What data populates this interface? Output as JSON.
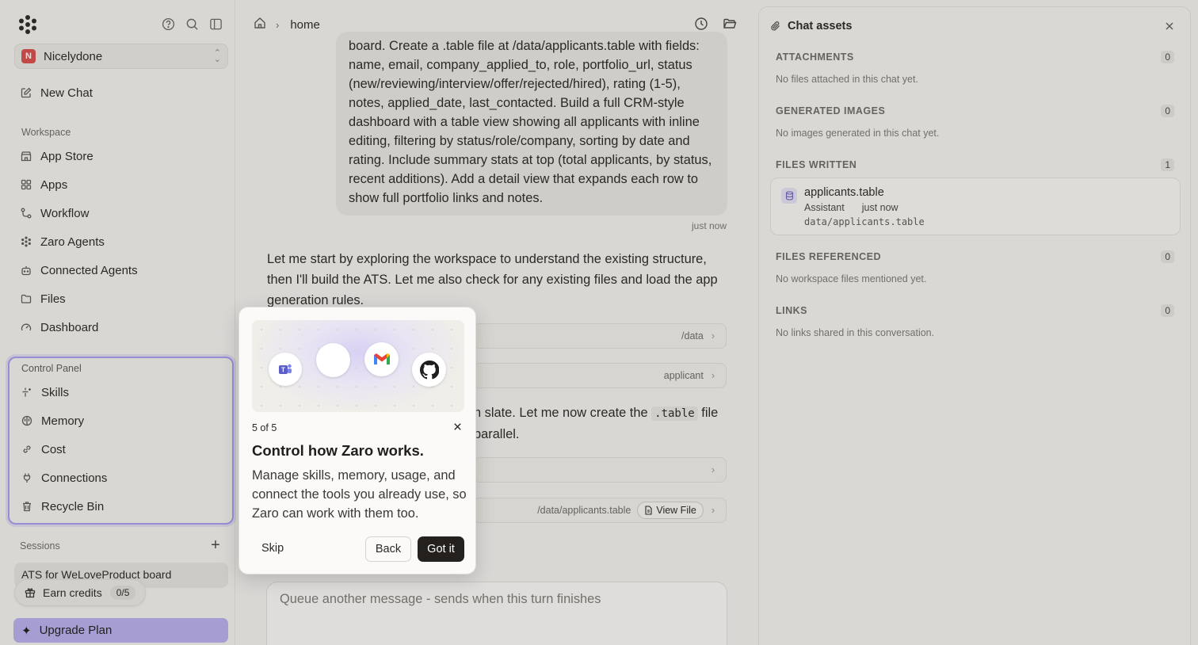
{
  "sidebar": {
    "workspace": {
      "initial": "N",
      "name": "Nicelydone"
    },
    "new_chat": "New Chat",
    "workspace_label": "Workspace",
    "nav": [
      {
        "label": "App Store",
        "icon": "store-icon"
      },
      {
        "label": "Apps",
        "icon": "grid-icon"
      },
      {
        "label": "Workflow",
        "icon": "workflow-icon"
      },
      {
        "label": "Zaro Agents",
        "icon": "zaro-agents-icon"
      },
      {
        "label": "Connected Agents",
        "icon": "robot-icon"
      },
      {
        "label": "Files",
        "icon": "folder-icon"
      },
      {
        "label": "Dashboard",
        "icon": "gauge-icon"
      }
    ],
    "control_panel": {
      "label": "Control Panel",
      "items": [
        {
          "label": "Skills",
          "icon": "sparkle-icon"
        },
        {
          "label": "Memory",
          "icon": "brain-icon"
        },
        {
          "label": "Cost",
          "icon": "link-icon"
        },
        {
          "label": "Connections",
          "icon": "plug-icon"
        },
        {
          "label": "Recycle Bin",
          "icon": "trash-icon"
        }
      ]
    },
    "sessions_label": "Sessions",
    "session_item": "ATS for WeLoveProduct board",
    "earn_credits": {
      "label": "Earn credits",
      "count": "0/5"
    },
    "upgrade": "Upgrade Plan"
  },
  "main": {
    "breadcrumb": "home",
    "user_message": "board. Create a .table file at /data/applicants.table with fields: name, email, company_applied_to, role, portfolio_url, status (new/reviewing/interview/offer/rejected/hired), rating (1-5), notes, applied_date, last_contacted. Build a full CRM-style dashboard with a table view showing all applicants with inline editing, filtering by status/role/company, sorting by date and rating. Include summary stats at top (total applicants, by status, recent additions). Add a detail view that expands each row to show full portfolio links and notes.",
    "message_time": "just now",
    "assistant_message": "Let me start by exploring the workspace to understand the existing structure, then I'll build the ATS. Let me also check for any existing files and load the app generation rules.",
    "tool_rows": [
      {
        "detail": "/data"
      },
      {
        "detail": "applicant"
      },
      {
        "detail": ""
      },
      {
        "detail": "/data/applicants.table",
        "action": "View File"
      }
    ],
    "assistant_message2": {
      "part1": "n slate. Let me now create the ",
      "code": ".table",
      "part2": " file",
      "part3": "parallel."
    },
    "composer_placeholder": "Queue another message - sends when this turn finishes"
  },
  "assets": {
    "title": "Chat assets",
    "sections": [
      {
        "title": "ATTACHMENTS",
        "count": "0",
        "empty": "No files attached in this chat yet."
      },
      {
        "title": "GENERATED IMAGES",
        "count": "0",
        "empty": "No images generated in this chat yet."
      },
      {
        "title": "FILES WRITTEN",
        "count": "1"
      },
      {
        "title": "FILES REFERENCED",
        "count": "0",
        "empty": "No workspace files mentioned yet."
      },
      {
        "title": "LINKS",
        "count": "0",
        "empty": "No links shared in this conversation."
      }
    ],
    "file": {
      "name": "applicants.table",
      "author": "Assistant",
      "time": "just now",
      "path": "data/applicants.table"
    }
  },
  "tour": {
    "step": "5 of 5",
    "title": "Control how Zaro works.",
    "body": "Manage skills, memory, usage, and connect the tools you already use, so Zaro can work with them too.",
    "skip": "Skip",
    "back": "Back",
    "got_it": "Got it",
    "hero_icons": [
      "teams-icon",
      "blank-circle",
      "gmail-icon",
      "github-icon"
    ]
  },
  "colors": {
    "accent": "#a79df0",
    "upgrade_bg": "#b9b0ee",
    "primary_button": "#23201d"
  }
}
